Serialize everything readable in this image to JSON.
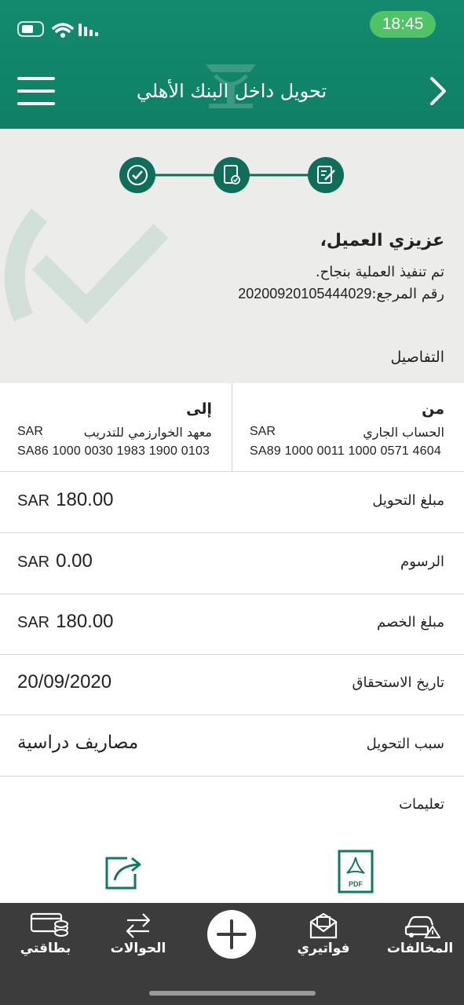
{
  "status_bar": {
    "time": "18:45"
  },
  "header": {
    "title": "تحويل داخل البنك الأهلي"
  },
  "success": {
    "greeting": "عزيزي العميل،",
    "message": "تم تنفيذ العملية بنجاح.",
    "ref_label": "رقم المرجع:",
    "ref_number": "20200920105444029",
    "details_title": "التفاصيل"
  },
  "from": {
    "heading": "من",
    "name": "الحساب الجاري",
    "currency": "SAR",
    "iban": "SA89 1000 0011 1000 0571 4604"
  },
  "to": {
    "heading": "إلى",
    "name": "معهد الخوارزمي للتدريب",
    "currency": "SAR",
    "iban": "SA86 1000 0030 1983 1900 0103"
  },
  "details": [
    {
      "label": "مبلغ التحويل",
      "currency": "SAR",
      "amount": "180.00"
    },
    {
      "label": "الرسوم",
      "currency": "SAR",
      "amount": "0.00"
    },
    {
      "label": "مبلغ الخصم",
      "currency": "SAR",
      "amount": "180.00"
    },
    {
      "label": "تاريخ الاستحقاق",
      "value": "20/09/2020"
    },
    {
      "label": "سبب التحويل",
      "value": "مصاريف دراسية"
    },
    {
      "label": "تعليمات",
      "value": ""
    }
  ],
  "actions": {
    "pdf_label": "PDF"
  },
  "tabs": {
    "violations": "المخالفات",
    "bills": "فواتيري",
    "transfers": "الحوالات",
    "cards": "بطاقتي"
  },
  "colors": {
    "brand": "#138a6e",
    "step": "#0f6e5a",
    "tabbar": "#3c3c3c",
    "time_pill": "#52c267"
  }
}
